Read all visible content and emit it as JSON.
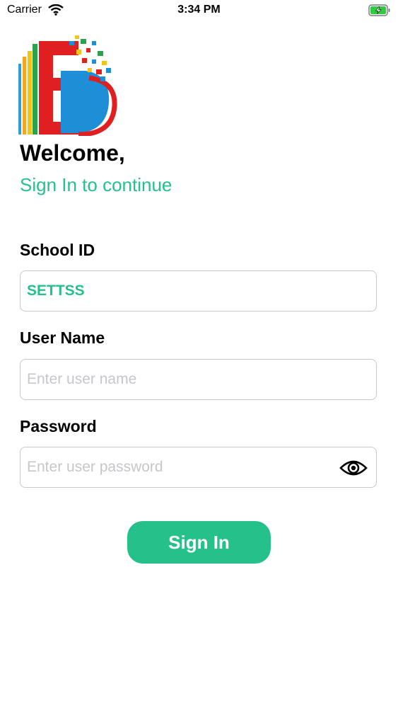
{
  "status_bar": {
    "carrier": "Carrier",
    "time": "3:34 PM",
    "wifi_icon": "wifi-icon",
    "battery_icon": "battery-charging-icon"
  },
  "logo": {
    "icon": "school-app-logo"
  },
  "welcome": "Welcome,",
  "subtitle": "Sign In to continue",
  "school_id": {
    "label": "School ID",
    "value": "SETTSS"
  },
  "user_name": {
    "label": "User Name",
    "value": "",
    "placeholder": "Enter user name"
  },
  "password": {
    "label": "Password",
    "value": "",
    "placeholder": "Enter user password",
    "toggle_icon": "eye-icon"
  },
  "sign_in_button": "Sign In",
  "colors": {
    "accent": "#26c08a",
    "placeholder": "#c6c6cc",
    "field_border": "#c8c8cc"
  }
}
